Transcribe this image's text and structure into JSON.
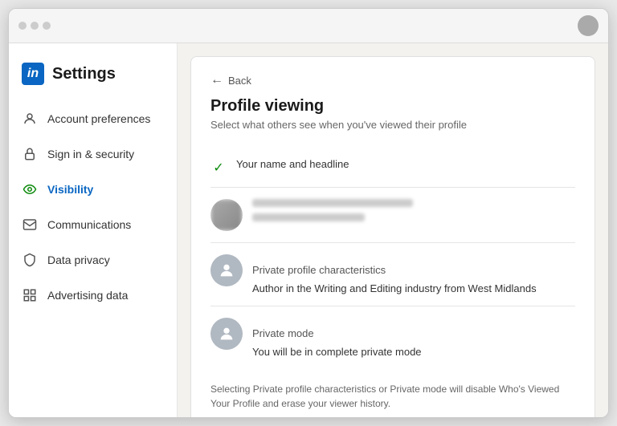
{
  "browser": {
    "dots": [
      "dot1",
      "dot2",
      "dot3"
    ]
  },
  "sidebar": {
    "logo_text": "in",
    "title": "Settings",
    "nav_items": [
      {
        "id": "account-preferences",
        "label": "Account preferences",
        "icon": "👤",
        "icon_type": "gray",
        "active": false
      },
      {
        "id": "sign-security",
        "label": "Sign in & security",
        "icon": "🔒",
        "icon_type": "gray",
        "active": false
      },
      {
        "id": "visibility",
        "label": "Visibility",
        "icon": "👁",
        "icon_type": "green",
        "active": true
      },
      {
        "id": "communications",
        "label": "Communications",
        "icon": "✉",
        "icon_type": "gray",
        "active": false
      },
      {
        "id": "data-privacy",
        "label": "Data privacy",
        "icon": "🛡",
        "icon_type": "gray",
        "active": false
      },
      {
        "id": "advertising-data",
        "label": "Advertising data",
        "icon": "⊞",
        "icon_type": "gray",
        "active": false
      }
    ]
  },
  "main": {
    "back_label": "Back",
    "page_title": "Profile viewing",
    "page_subtitle": "Select what others see when you've viewed their profile",
    "options": [
      {
        "id": "your-name",
        "type": "checked-with-avatar",
        "check": "✓",
        "label": "Your name and headline"
      },
      {
        "id": "private-profile",
        "type": "section",
        "section_label": "Private profile characteristics",
        "description": "Author in the Writing and Editing industry from West Midlands"
      },
      {
        "id": "private-mode",
        "type": "section",
        "section_label": "Private mode",
        "description": "You will be in complete private mode"
      }
    ],
    "footer_note": "Selecting Private profile characteristics or Private mode will disable Who's Viewed Your Profile and erase your viewer history."
  }
}
